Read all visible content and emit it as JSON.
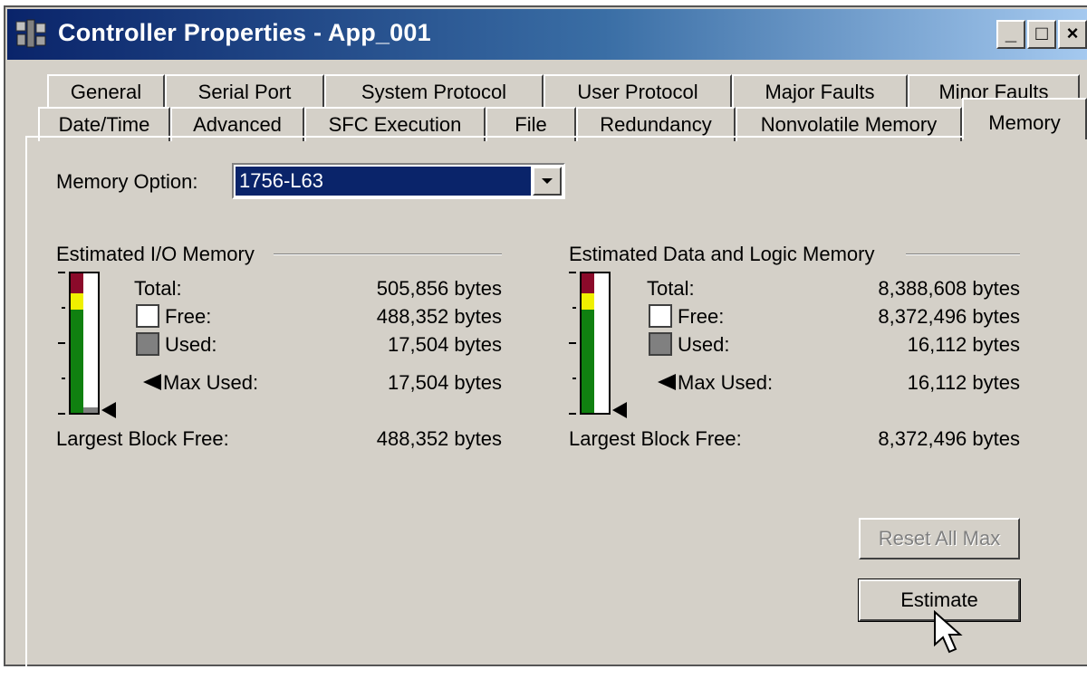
{
  "window": {
    "title": "Controller Properties - App_001",
    "minimize": "_",
    "maximize": "□",
    "close": "×"
  },
  "tabs_row1": [
    "General",
    "Serial Port",
    "System Protocol",
    "User Protocol",
    "Major Faults",
    "Minor Faults"
  ],
  "tabs_row2": [
    "Date/Time",
    "Advanced",
    "SFC Execution",
    "File",
    "Redundancy",
    "Nonvolatile Memory",
    "Memory"
  ],
  "active_tab": "Memory",
  "memory_option": {
    "label": "Memory Option:",
    "value": "1756-L63"
  },
  "io_memory": {
    "title": "Estimated I/O Memory",
    "total_label": "Total:",
    "total": "505,856 bytes",
    "free_label": "Free:",
    "free": "488,352 bytes",
    "used_label": "Used:",
    "used": "17,504 bytes",
    "max_used_label": "Max Used:",
    "max_used": "17,504 bytes",
    "largest_label": "Largest Block Free:",
    "largest": "488,352 bytes",
    "used_fraction": 0.035
  },
  "data_memory": {
    "title": "Estimated Data and Logic Memory",
    "total_label": "Total:",
    "total": "8,388,608 bytes",
    "free_label": "Free:",
    "free": "8,372,496 bytes",
    "used_label": "Used:",
    "used": "16,112 bytes",
    "max_used_label": "Max Used:",
    "max_used": "16,112 bytes",
    "largest_label": "Largest Block Free:",
    "largest": "8,372,496 bytes",
    "used_fraction": 0.002
  },
  "buttons": {
    "reset_all_max": "Reset All Max",
    "estimate": "Estimate"
  },
  "colors": {
    "title_start": "#0a246a",
    "title_end": "#a6caf0",
    "gauge_red": "#8b0a2a",
    "gauge_yellow": "#f0f000",
    "gauge_green": "#108010",
    "selection": "#0a246a"
  }
}
